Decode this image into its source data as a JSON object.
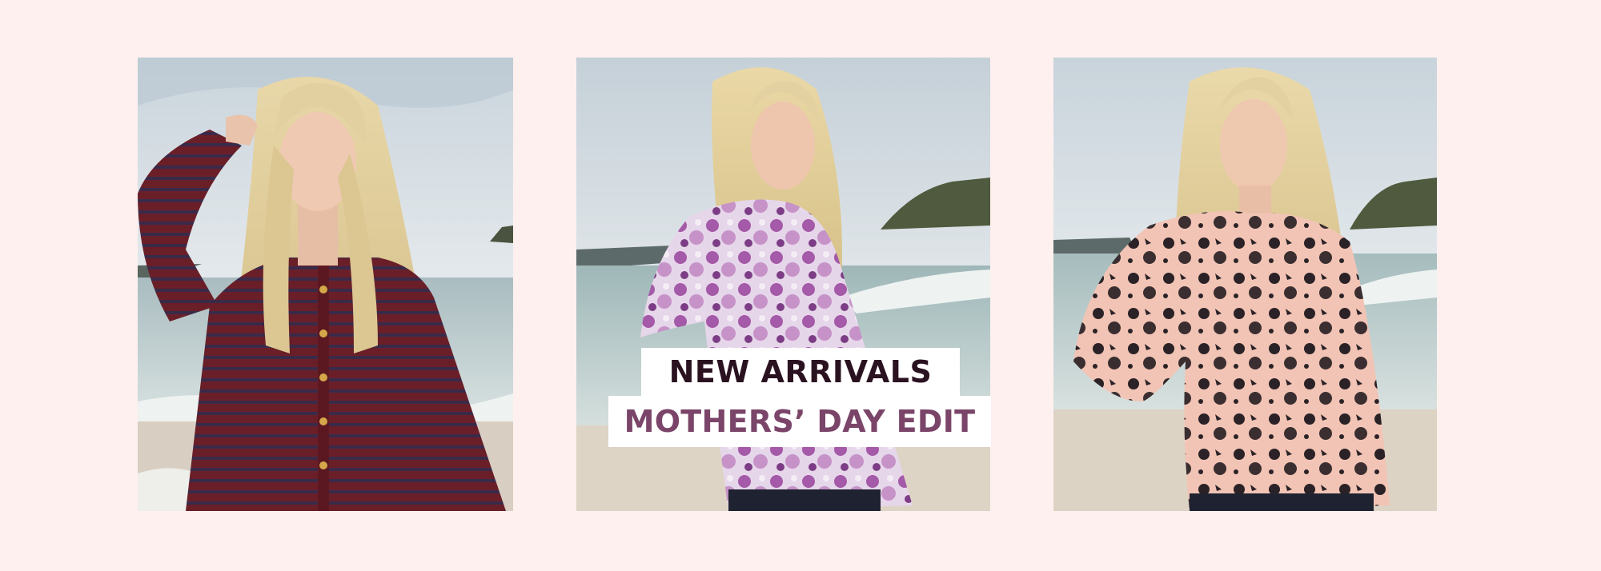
{
  "banner": {
    "line1": "NEW ARRIVALS",
    "line2": "MOTHERS’ DAY EDIT"
  },
  "colors": {
    "page_background": "#fdf0ef",
    "headline_dark": "#2b1221",
    "headline_plum": "#7a4569",
    "banner_background": "#ffffff"
  },
  "panels": [
    {
      "subject": "woman in burgundy striped cardigan with gold buttons on a beach"
    },
    {
      "subject": "woman in purple floral blouse looking over shoulder on a beach"
    },
    {
      "subject": "woman in peach blouse with black floral print on a beach"
    }
  ]
}
